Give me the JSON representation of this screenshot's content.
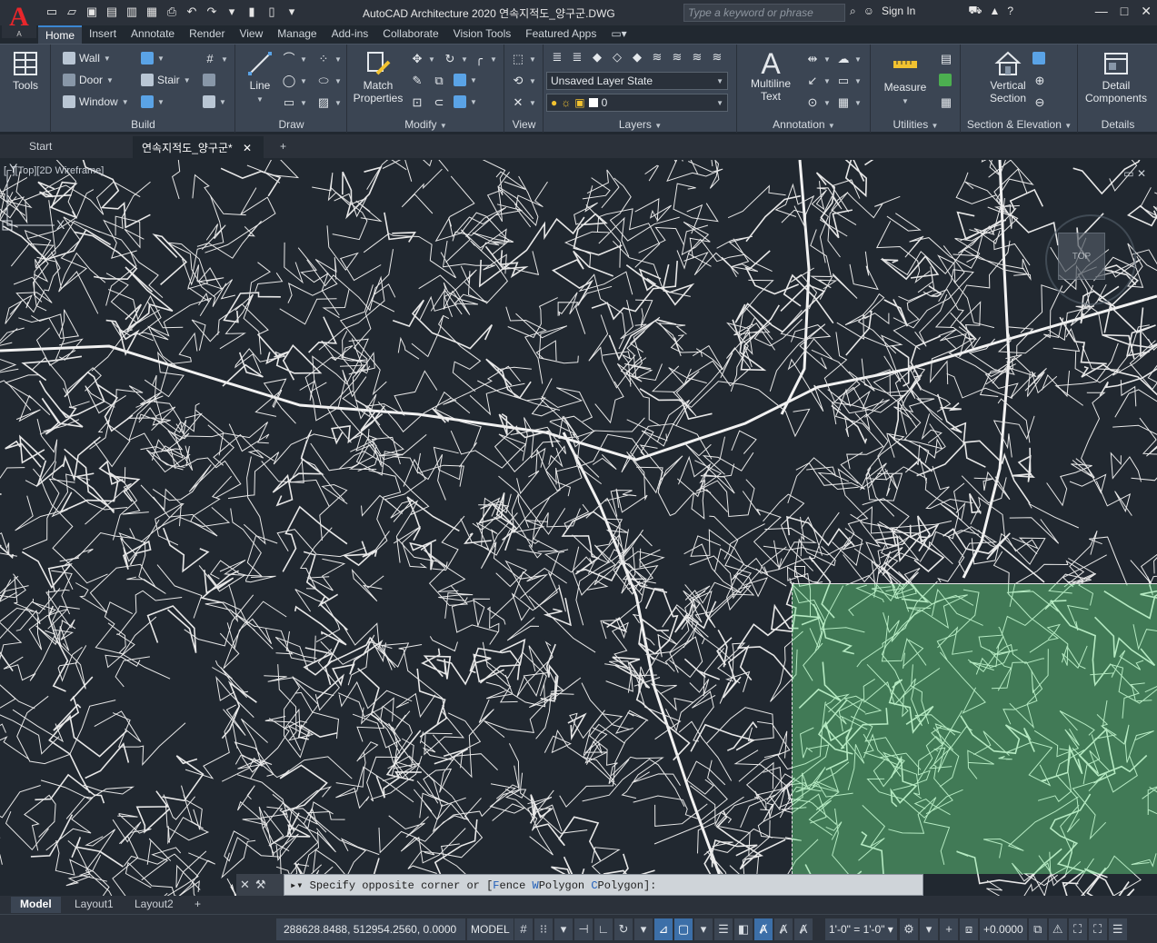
{
  "window": {
    "title": "AutoCAD Architecture 2020    연속지적도_양구군.DWG",
    "search_placeholder": "Type a keyword or phrase",
    "sign_in": "Sign In",
    "app_letter": "A",
    "app_sub": "A"
  },
  "ribbon": {
    "tabs": [
      "Home",
      "Insert",
      "Annotate",
      "Render",
      "View",
      "Manage",
      "Add-ins",
      "Collaborate",
      "Vision Tools",
      "Featured Apps"
    ],
    "active_tab": "Home",
    "tools_label": "Tools",
    "build": {
      "title": "Build",
      "wall": "Wall",
      "door": "Door",
      "window": "Window",
      "stair": "Stair"
    },
    "draw": {
      "title": "Draw",
      "line": "Line"
    },
    "modify": {
      "title": "Modify",
      "match": "Match",
      "properties": "Properties"
    },
    "view": {
      "title": "View"
    },
    "layers": {
      "title": "Layers",
      "layer_state": "Unsaved Layer State",
      "current_layer": "0"
    },
    "annotation": {
      "title": "Annotation",
      "multiline": "Multiline",
      "text": "Text"
    },
    "utilities": {
      "title": "Utilities",
      "measure": "Measure"
    },
    "section": {
      "title": "Section & Elevation",
      "vertical": "Vertical",
      "section": "Section"
    },
    "details": {
      "title": "Details",
      "detail": "Detail",
      "components": "Components"
    }
  },
  "doc_tabs": {
    "start": "Start",
    "active": "연속지적도_양구군*"
  },
  "viewport": {
    "label": "[−][Top][2D Wireframe]",
    "viewcube": "TOP"
  },
  "ucs": {
    "x": "X",
    "y": "Y"
  },
  "command": {
    "prompt": "Specify opposite corner or ",
    "bracket_open": "[",
    "opt1_key": "F",
    "opt1_rest": "ence ",
    "opt2_key": "W",
    "opt2_rest": "Polygon ",
    "opt3_key": "C",
    "opt3_rest": "Polygon",
    "bracket_close": "]:"
  },
  "layout_tabs": [
    "Model",
    "Layout1",
    "Layout2"
  ],
  "status": {
    "coords": "288628.8488, 512954.2560, 0.0000",
    "model": "MODEL",
    "scale": "1'-0\" = 1'-0\"",
    "elevation": "+0.0000"
  },
  "colors": {
    "background": "#212830",
    "ribbon": "#3b4553",
    "selection": "#6eeb8c",
    "accent": "#3b86d1"
  }
}
